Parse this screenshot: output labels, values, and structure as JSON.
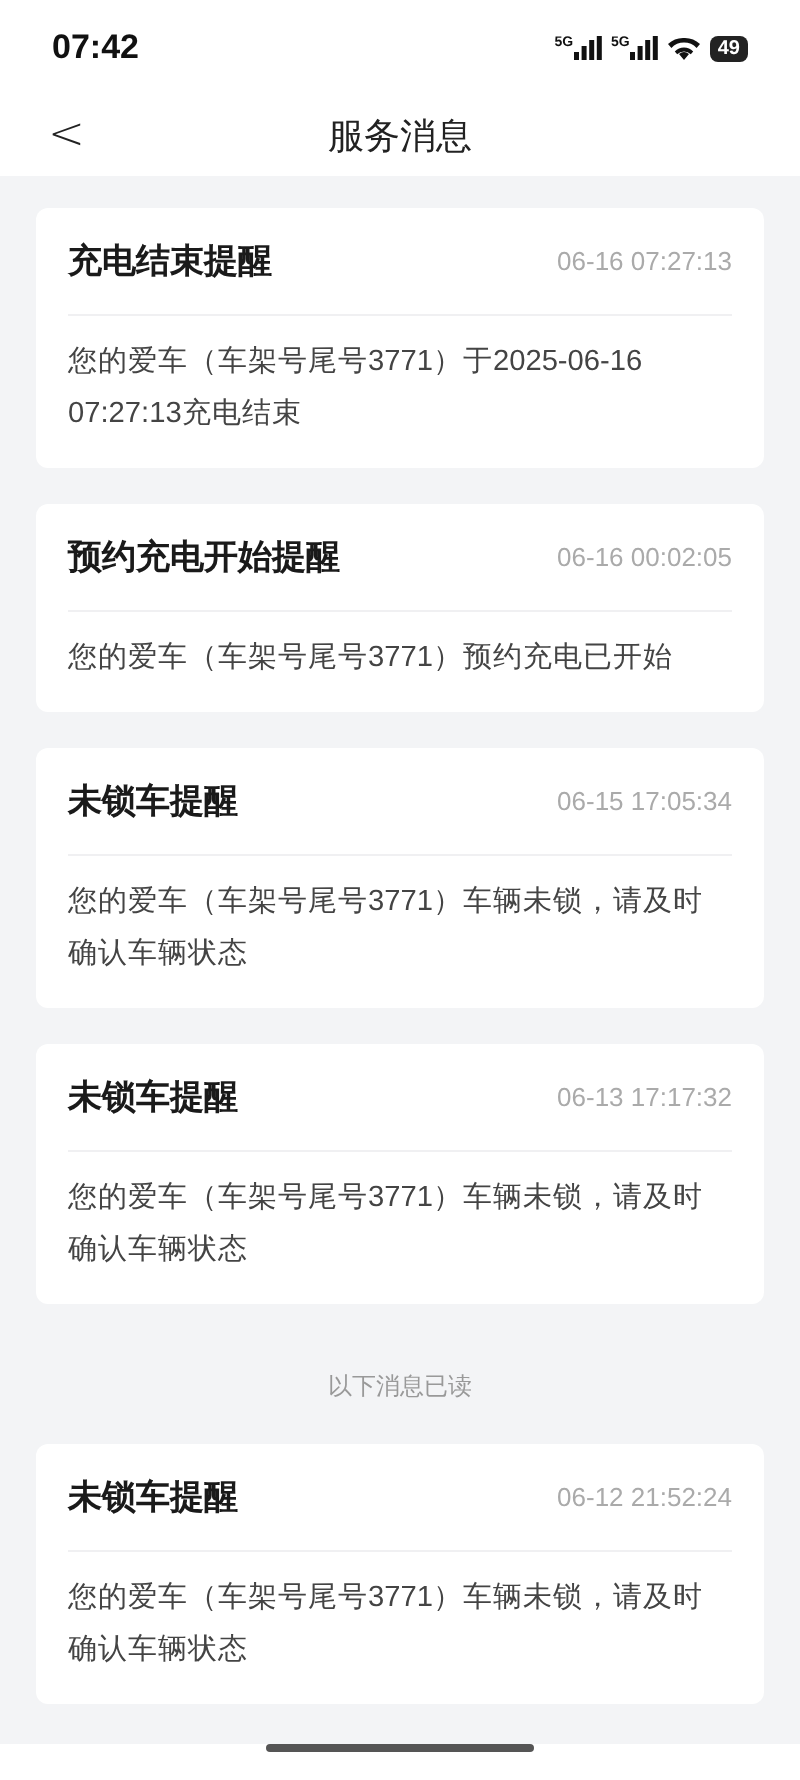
{
  "status_bar": {
    "time": "07:42",
    "network_1": "5G",
    "network_2": "5G",
    "battery": "49"
  },
  "nav": {
    "back": "<",
    "title": "服务消息"
  },
  "unread": [
    {
      "title": "充电结束提醒",
      "time": "06-16 07:27:13",
      "body": "您的爱车（车架号尾号3771）于2025-06-16 07:27:13充电结束"
    },
    {
      "title": "预约充电开始提醒",
      "time": "06-16 00:02:05",
      "body": "您的爱车（车架号尾号3771）预约充电已开始"
    },
    {
      "title": "未锁车提醒",
      "time": "06-15 17:05:34",
      "body": "您的爱车（车架号尾号3771）车辆未锁，请及时确认车辆状态"
    },
    {
      "title": "未锁车提醒",
      "time": "06-13 17:17:32",
      "body": "您的爱车（车架号尾号3771）车辆未锁，请及时确认车辆状态"
    }
  ],
  "read_divider": "以下消息已读",
  "read": [
    {
      "title": "未锁车提醒",
      "time": "06-12 21:52:24",
      "body": "您的爱车（车架号尾号3771）车辆未锁，请及时确认车辆状态"
    }
  ]
}
